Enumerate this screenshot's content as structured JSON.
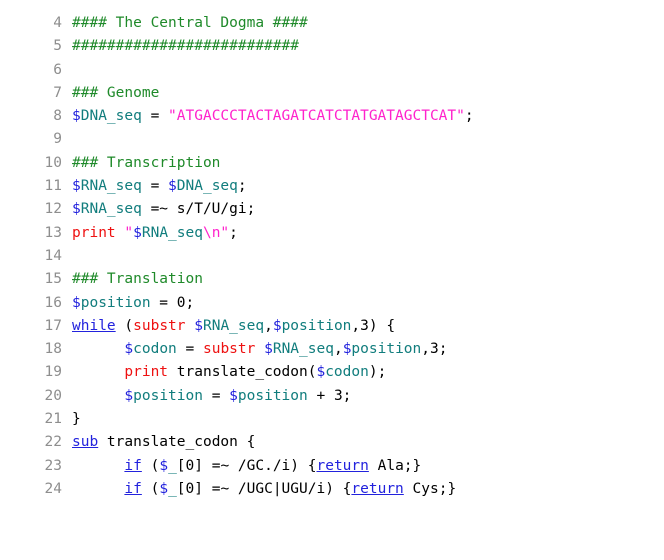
{
  "editor": {
    "title": "Perl source code listing",
    "language": "Perl",
    "first_line_number": 4,
    "last_line_number": 24,
    "colors": {
      "background": "#ffffff",
      "gutter_text": "#8e8e8e",
      "comment": "#1f8a2a",
      "variable": "#117d7d",
      "sigil": "#2222dd",
      "string": "#ff22cc",
      "function": "#ee1111",
      "keyword": "#2222dd",
      "plain": "#000000"
    }
  },
  "lines": [
    {
      "number": "4",
      "text": "#### The Central Dogma ####",
      "tokens": [
        {
          "t": "#### The Central Dogma ####",
          "c": "tok-comment"
        }
      ]
    },
    {
      "number": "5",
      "text": "##########################",
      "tokens": [
        {
          "t": "##########################",
          "c": "tok-comment"
        }
      ]
    },
    {
      "number": "6",
      "text": "",
      "tokens": []
    },
    {
      "number": "7",
      "text": "### Genome",
      "tokens": [
        {
          "t": "### Genome",
          "c": "tok-comment"
        }
      ]
    },
    {
      "number": "8",
      "text": "$DNA_seq = \"ATGACCCTACTAGATCATCTATGATAGCTCAT\";",
      "tokens": [
        {
          "t": "$",
          "c": "tok-sigil"
        },
        {
          "t": "DNA_seq",
          "c": "tok-var"
        },
        {
          "t": " = ",
          "c": "tok-plain"
        },
        {
          "t": "\"ATGACCCTACTAGATCATCTATGATAGCTCAT\"",
          "c": "tok-string"
        },
        {
          "t": ";",
          "c": "tok-plain"
        }
      ]
    },
    {
      "number": "9",
      "text": "",
      "tokens": []
    },
    {
      "number": "10",
      "text": "### Transcription",
      "tokens": [
        {
          "t": "### Transcription",
          "c": "tok-comment"
        }
      ]
    },
    {
      "number": "11",
      "text": "$RNA_seq = $DNA_seq;",
      "tokens": [
        {
          "t": "$",
          "c": "tok-sigil"
        },
        {
          "t": "RNA_seq",
          "c": "tok-var"
        },
        {
          "t": " = ",
          "c": "tok-plain"
        },
        {
          "t": "$",
          "c": "tok-sigil"
        },
        {
          "t": "DNA_seq",
          "c": "tok-var"
        },
        {
          "t": ";",
          "c": "tok-plain"
        }
      ]
    },
    {
      "number": "12",
      "text": "$RNA_seq =~ s/T/U/gi;",
      "tokens": [
        {
          "t": "$",
          "c": "tok-sigil"
        },
        {
          "t": "RNA_seq",
          "c": "tok-var"
        },
        {
          "t": " =~ s/T/U/gi;",
          "c": "tok-plain"
        }
      ]
    },
    {
      "number": "13",
      "text": "print \"$RNA_seq\\n\";",
      "tokens": [
        {
          "t": "print",
          "c": "tok-func"
        },
        {
          "t": " ",
          "c": "tok-plain"
        },
        {
          "t": "\"",
          "c": "tok-string"
        },
        {
          "t": "$",
          "c": "tok-sigil"
        },
        {
          "t": "RNA_seq",
          "c": "tok-var"
        },
        {
          "t": "\\n\"",
          "c": "tok-string"
        },
        {
          "t": ";",
          "c": "tok-plain"
        }
      ]
    },
    {
      "number": "14",
      "text": "",
      "tokens": []
    },
    {
      "number": "15",
      "text": "### Translation",
      "tokens": [
        {
          "t": "### Translation",
          "c": "tok-comment"
        }
      ]
    },
    {
      "number": "16",
      "text": "$position = 0;",
      "tokens": [
        {
          "t": "$",
          "c": "tok-sigil"
        },
        {
          "t": "position",
          "c": "tok-var"
        },
        {
          "t": " = 0;",
          "c": "tok-plain"
        }
      ]
    },
    {
      "number": "17",
      "text": "while (substr $RNA_seq,$position,3) {",
      "tokens": [
        {
          "t": "while",
          "c": "tok-keyword"
        },
        {
          "t": " (",
          "c": "tok-plain"
        },
        {
          "t": "substr",
          "c": "tok-func"
        },
        {
          "t": " ",
          "c": "tok-plain"
        },
        {
          "t": "$",
          "c": "tok-sigil"
        },
        {
          "t": "RNA_seq",
          "c": "tok-var"
        },
        {
          "t": ",",
          "c": "tok-plain"
        },
        {
          "t": "$",
          "c": "tok-sigil"
        },
        {
          "t": "position",
          "c": "tok-var"
        },
        {
          "t": ",3) {",
          "c": "tok-plain"
        }
      ]
    },
    {
      "number": "18",
      "text": "      $codon = substr $RNA_seq,$position,3;",
      "tokens": [
        {
          "t": "      ",
          "c": "tok-plain"
        },
        {
          "t": "$",
          "c": "tok-sigil"
        },
        {
          "t": "codon",
          "c": "tok-var"
        },
        {
          "t": " = ",
          "c": "tok-plain"
        },
        {
          "t": "substr",
          "c": "tok-func"
        },
        {
          "t": " ",
          "c": "tok-plain"
        },
        {
          "t": "$",
          "c": "tok-sigil"
        },
        {
          "t": "RNA_seq",
          "c": "tok-var"
        },
        {
          "t": ",",
          "c": "tok-plain"
        },
        {
          "t": "$",
          "c": "tok-sigil"
        },
        {
          "t": "position",
          "c": "tok-var"
        },
        {
          "t": ",3;",
          "c": "tok-plain"
        }
      ]
    },
    {
      "number": "19",
      "text": "      print translate_codon($codon);",
      "tokens": [
        {
          "t": "      ",
          "c": "tok-plain"
        },
        {
          "t": "print",
          "c": "tok-func"
        },
        {
          "t": " translate_codon(",
          "c": "tok-plain"
        },
        {
          "t": "$",
          "c": "tok-sigil"
        },
        {
          "t": "codon",
          "c": "tok-var"
        },
        {
          "t": ");",
          "c": "tok-plain"
        }
      ]
    },
    {
      "number": "20",
      "text": "      $position = $position + 3;",
      "tokens": [
        {
          "t": "      ",
          "c": "tok-plain"
        },
        {
          "t": "$",
          "c": "tok-sigil"
        },
        {
          "t": "position",
          "c": "tok-var"
        },
        {
          "t": " = ",
          "c": "tok-plain"
        },
        {
          "t": "$",
          "c": "tok-sigil"
        },
        {
          "t": "position",
          "c": "tok-var"
        },
        {
          "t": " + 3;",
          "c": "tok-plain"
        }
      ]
    },
    {
      "number": "21",
      "text": "}",
      "tokens": [
        {
          "t": "}",
          "c": "tok-plain"
        }
      ]
    },
    {
      "number": "22",
      "text": "sub translate_codon {",
      "tokens": [
        {
          "t": "sub",
          "c": "tok-keyword"
        },
        {
          "t": " translate_codon {",
          "c": "tok-plain"
        }
      ]
    },
    {
      "number": "23",
      "text": "      if ($_[0] =~ /GC./i) {return Ala;}",
      "tokens": [
        {
          "t": "      ",
          "c": "tok-plain"
        },
        {
          "t": "if",
          "c": "tok-keyword"
        },
        {
          "t": " (",
          "c": "tok-plain"
        },
        {
          "t": "$",
          "c": "tok-sigil"
        },
        {
          "t": "_",
          "c": "tok-var"
        },
        {
          "t": "[0] =~ /GC./i) {",
          "c": "tok-plain"
        },
        {
          "t": "return",
          "c": "tok-keyword"
        },
        {
          "t": " Ala;}",
          "c": "tok-plain"
        }
      ]
    },
    {
      "number": "24",
      "text": "      if ($_[0] =~ /UGC|UGU/i) {return Cys;}",
      "tokens": [
        {
          "t": "      ",
          "c": "tok-plain"
        },
        {
          "t": "if",
          "c": "tok-keyword"
        },
        {
          "t": " (",
          "c": "tok-plain"
        },
        {
          "t": "$",
          "c": "tok-sigil"
        },
        {
          "t": "_",
          "c": "tok-var"
        },
        {
          "t": "[0] =~ /UGC|UGU/i) {",
          "c": "tok-plain"
        },
        {
          "t": "return",
          "c": "tok-keyword"
        },
        {
          "t": " Cys;}",
          "c": "tok-plain"
        }
      ]
    }
  ]
}
